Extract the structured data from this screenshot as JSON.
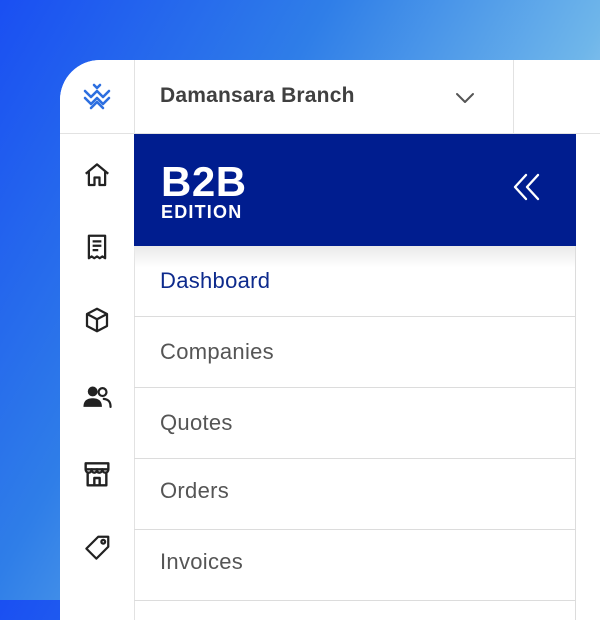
{
  "branch": {
    "name": "Damansara Branch",
    "chevron_icon": "chevron-down-icon"
  },
  "banner": {
    "title": "B2B",
    "subtitle": "EDITION",
    "collapse_icon": "double-chevron-left-icon",
    "background": "#001d8f"
  },
  "rail": {
    "logo_icon": "brand-logo-icon",
    "icons": [
      "home-icon",
      "receipt-icon",
      "box-icon",
      "users-icon",
      "store-icon",
      "tag-icon"
    ]
  },
  "menu": {
    "items": [
      {
        "label": "Dashboard",
        "active": true
      },
      {
        "label": "Companies",
        "active": false
      },
      {
        "label": "Quotes",
        "active": false
      },
      {
        "label": "Orders",
        "active": false
      },
      {
        "label": "Invoices",
        "active": false
      }
    ]
  },
  "colors": {
    "accent": "#0d2a8c",
    "logo_blue": "#2d6fe0"
  }
}
